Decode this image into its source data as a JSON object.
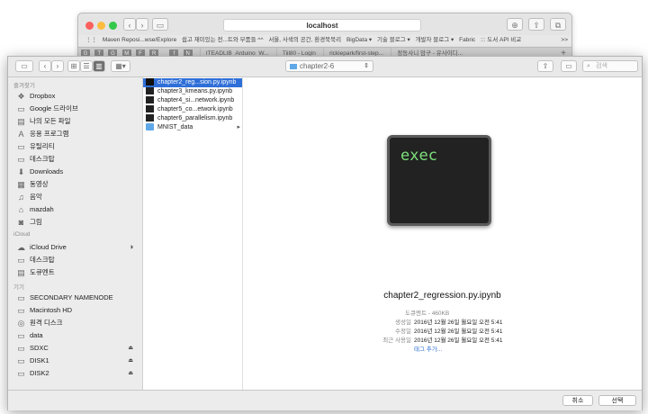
{
  "browser": {
    "url": "localhost",
    "bookmarks": [
      "Maven Reposi...wse/Explore",
      "쉽고 재미있는 전...트와 부품들 ^^",
      "서울, 사색의 공간, 환경북북리",
      "BigData ▾",
      "기술 블로그 ▾",
      "개발자 블로그 ▾",
      "Fabric",
      "::: 도서 API 비교"
    ],
    "favicons": [
      "G",
      "T",
      "G",
      "M",
      "F",
      "R",
      "f",
      "N"
    ],
    "tabs": [
      "ITEADLIB_Arduino_W...",
      "Tiil80 - Login",
      "rickiepark/first-step...",
      "정동사니 암구 - 유사이디..."
    ],
    "more": ">>"
  },
  "dialog": {
    "path": "chapter2-6",
    "search_placeholder": "검색",
    "sidebar": {
      "favorites_header": "즐겨찾기",
      "favorites": [
        {
          "label": "Dropbox",
          "icon": "dropbox-icon",
          "glyph": "❖"
        },
        {
          "label": "Google 드라이브",
          "icon": "google-drive-icon",
          "glyph": "▭"
        },
        {
          "label": "나의 모든 파일",
          "icon": "all-files-icon",
          "glyph": "▤"
        },
        {
          "label": "응용 프로그램",
          "icon": "applications-icon",
          "glyph": "A"
        },
        {
          "label": "유틸리티",
          "icon": "folder-icon",
          "glyph": "▭"
        },
        {
          "label": "데스크탑",
          "icon": "desktop-icon",
          "glyph": "▭"
        },
        {
          "label": "Downloads",
          "icon": "downloads-icon",
          "glyph": "⬇"
        },
        {
          "label": "동영상",
          "icon": "movies-icon",
          "glyph": "▦"
        },
        {
          "label": "음악",
          "icon": "music-icon",
          "glyph": "♫"
        },
        {
          "label": "mazdah",
          "icon": "home-icon",
          "glyph": "⌂"
        },
        {
          "label": "그림",
          "icon": "pictures-icon",
          "glyph": "◙"
        }
      ],
      "icloud_header": "iCloud",
      "icloud": [
        {
          "label": "iCloud Drive",
          "icon": "icloud-icon",
          "glyph": "☁"
        },
        {
          "label": "데스크탑",
          "icon": "desktop-icon",
          "glyph": "▭"
        },
        {
          "label": "도큐멘트",
          "icon": "documents-icon",
          "glyph": "▤"
        }
      ],
      "devices_header": "기기",
      "devices": [
        {
          "label": "SECONDARY NAMENODE",
          "icon": "network-computer-icon",
          "glyph": "▭",
          "eject": false
        },
        {
          "label": "Macintosh HD",
          "icon": "hard-disk-icon",
          "glyph": "▭",
          "eject": false
        },
        {
          "label": "원격 디스크",
          "icon": "remote-disc-icon",
          "glyph": "◎",
          "eject": false
        },
        {
          "label": "data",
          "icon": "disk-icon",
          "glyph": "▭",
          "eject": false
        },
        {
          "label": "SDXC",
          "icon": "disk-icon",
          "glyph": "▭",
          "eject": true
        },
        {
          "label": "DISK1",
          "icon": "disk-icon",
          "glyph": "▭",
          "eject": true
        },
        {
          "label": "DISK2",
          "icon": "disk-icon",
          "glyph": "▭",
          "eject": true
        }
      ]
    },
    "files": [
      {
        "label": "chapter2_reg...sion.py.ipynb",
        "selected": true,
        "folder": false
      },
      {
        "label": "chapter3_kmeans.py.ipynb",
        "selected": false,
        "folder": false
      },
      {
        "label": "chapter4_si...network.ipynb",
        "selected": false,
        "folder": false
      },
      {
        "label": "chapter5_co...etwork.ipynb",
        "selected": false,
        "folder": false
      },
      {
        "label": "chapter6_parallelism.ipynb",
        "selected": false,
        "folder": false
      },
      {
        "label": "MNIST_data",
        "selected": false,
        "folder": true
      }
    ],
    "preview": {
      "icon_text": "exec",
      "filename": "chapter2_regression.py.ipynb",
      "meta": [
        {
          "key": "도큐멘트 - 460KB",
          "value": ""
        },
        {
          "key": "생성일",
          "value": "2016년 12월 26일 월요일 오전 5:41"
        },
        {
          "key": "수정일",
          "value": "2016년 12월 26일 월요일 오전 5:41"
        },
        {
          "key": "최근 사용일",
          "value": "2016년 12월 26일 월요일 오전 5:41"
        },
        {
          "key": "",
          "value": "태그 추가..."
        }
      ]
    },
    "buttons": {
      "cancel": "취소",
      "select": "선택"
    }
  },
  "colors": {
    "accent": "#2f6fd8",
    "exec_text": "#7ce07a"
  }
}
